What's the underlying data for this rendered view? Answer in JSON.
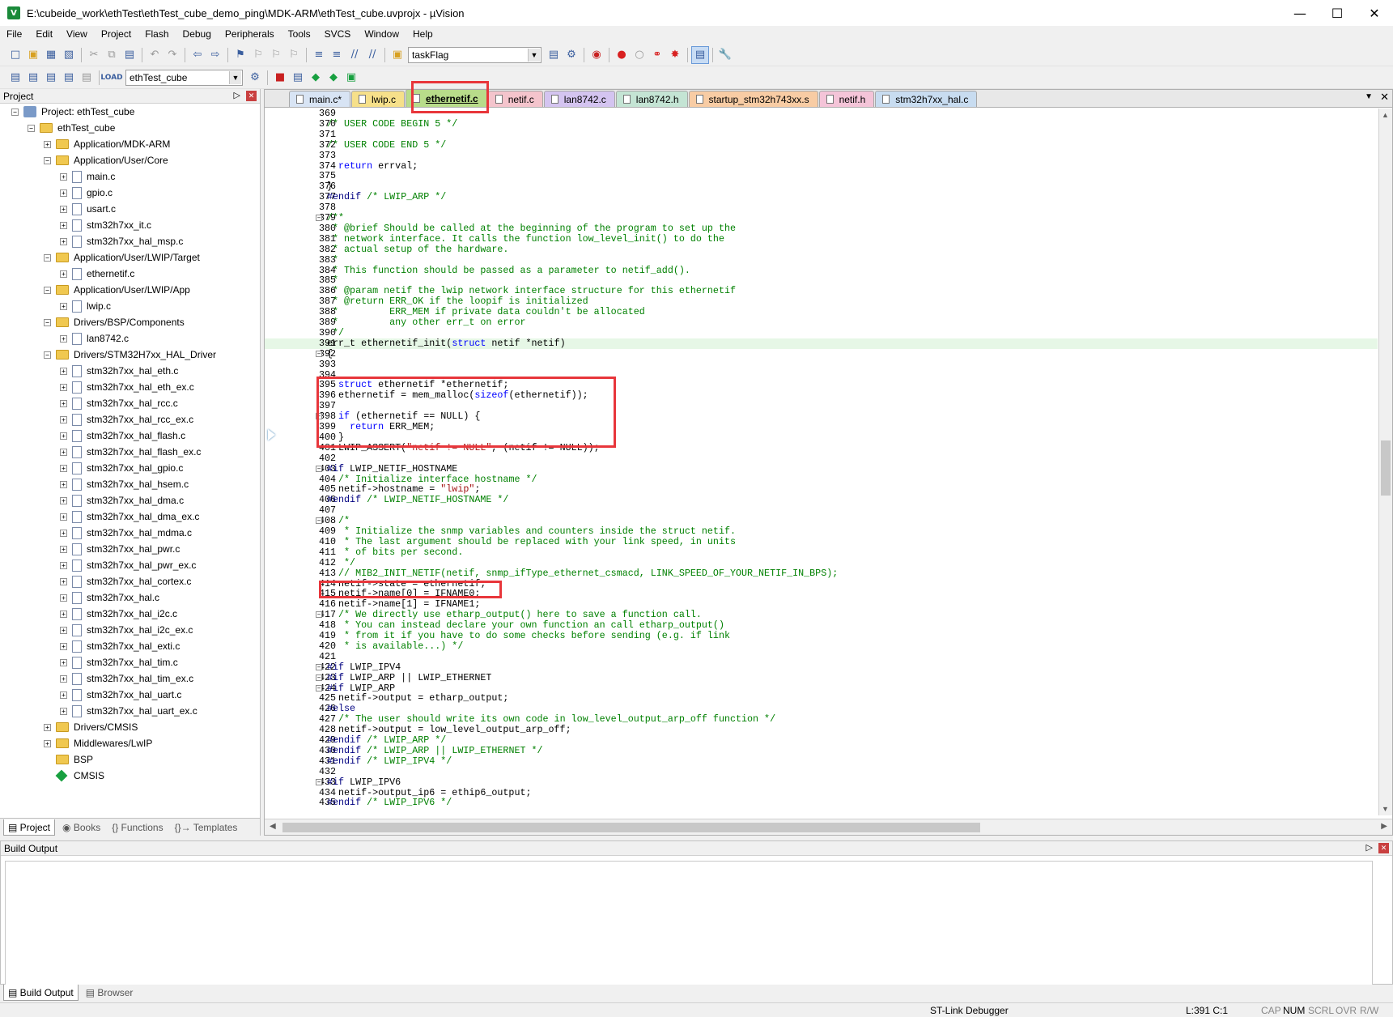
{
  "window": {
    "title": "E:\\cubeide_work\\ethTest\\ethTest_cube_demo_ping\\MDK-ARM\\ethTest_cube.uvprojx - µVision",
    "minimize": "—",
    "maximize": "☐",
    "close": "✕"
  },
  "menu": [
    "File",
    "Edit",
    "View",
    "Project",
    "Flash",
    "Debug",
    "Peripherals",
    "Tools",
    "SVCS",
    "Window",
    "Help"
  ],
  "toolbar": {
    "find_combo": "taskFlag",
    "target_combo": "ethTest_cube"
  },
  "project_panel": {
    "title": "Project",
    "tree": [
      {
        "label": "Project: ethTest_cube",
        "level": 0,
        "kind": "project",
        "expander": "−"
      },
      {
        "label": "ethTest_cube",
        "level": 1,
        "kind": "target",
        "expander": "−"
      },
      {
        "label": "Application/MDK-ARM",
        "level": 2,
        "kind": "folder",
        "expander": "+"
      },
      {
        "label": "Application/User/Core",
        "level": 2,
        "kind": "folder",
        "expander": "−"
      },
      {
        "label": "main.c",
        "level": 3,
        "kind": "file",
        "expander": "+"
      },
      {
        "label": "gpio.c",
        "level": 3,
        "kind": "file",
        "expander": "+"
      },
      {
        "label": "usart.c",
        "level": 3,
        "kind": "file",
        "expander": "+"
      },
      {
        "label": "stm32h7xx_it.c",
        "level": 3,
        "kind": "file",
        "expander": "+"
      },
      {
        "label": "stm32h7xx_hal_msp.c",
        "level": 3,
        "kind": "file",
        "expander": "+"
      },
      {
        "label": "Application/User/LWIP/Target",
        "level": 2,
        "kind": "folder",
        "expander": "−"
      },
      {
        "label": "ethernetif.c",
        "level": 3,
        "kind": "file",
        "expander": "+"
      },
      {
        "label": "Application/User/LWIP/App",
        "level": 2,
        "kind": "folder",
        "expander": "−"
      },
      {
        "label": "lwip.c",
        "level": 3,
        "kind": "file",
        "expander": "+"
      },
      {
        "label": "Drivers/BSP/Components",
        "level": 2,
        "kind": "folder",
        "expander": "−"
      },
      {
        "label": "lan8742.c",
        "level": 3,
        "kind": "file",
        "expander": "+"
      },
      {
        "label": "Drivers/STM32H7xx_HAL_Driver",
        "level": 2,
        "kind": "folder",
        "expander": "−"
      },
      {
        "label": "stm32h7xx_hal_eth.c",
        "level": 3,
        "kind": "file",
        "expander": "+"
      },
      {
        "label": "stm32h7xx_hal_eth_ex.c",
        "level": 3,
        "kind": "file",
        "expander": "+"
      },
      {
        "label": "stm32h7xx_hal_rcc.c",
        "level": 3,
        "kind": "file",
        "expander": "+"
      },
      {
        "label": "stm32h7xx_hal_rcc_ex.c",
        "level": 3,
        "kind": "file",
        "expander": "+"
      },
      {
        "label": "stm32h7xx_hal_flash.c",
        "level": 3,
        "kind": "file",
        "expander": "+"
      },
      {
        "label": "stm32h7xx_hal_flash_ex.c",
        "level": 3,
        "kind": "file",
        "expander": "+"
      },
      {
        "label": "stm32h7xx_hal_gpio.c",
        "level": 3,
        "kind": "file",
        "expander": "+"
      },
      {
        "label": "stm32h7xx_hal_hsem.c",
        "level": 3,
        "kind": "file",
        "expander": "+"
      },
      {
        "label": "stm32h7xx_hal_dma.c",
        "level": 3,
        "kind": "file",
        "expander": "+"
      },
      {
        "label": "stm32h7xx_hal_dma_ex.c",
        "level": 3,
        "kind": "file",
        "expander": "+"
      },
      {
        "label": "stm32h7xx_hal_mdma.c",
        "level": 3,
        "kind": "file",
        "expander": "+"
      },
      {
        "label": "stm32h7xx_hal_pwr.c",
        "level": 3,
        "kind": "file",
        "expander": "+"
      },
      {
        "label": "stm32h7xx_hal_pwr_ex.c",
        "level": 3,
        "kind": "file",
        "expander": "+"
      },
      {
        "label": "stm32h7xx_hal_cortex.c",
        "level": 3,
        "kind": "file",
        "expander": "+"
      },
      {
        "label": "stm32h7xx_hal.c",
        "level": 3,
        "kind": "file",
        "expander": "+"
      },
      {
        "label": "stm32h7xx_hal_i2c.c",
        "level": 3,
        "kind": "file",
        "expander": "+"
      },
      {
        "label": "stm32h7xx_hal_i2c_ex.c",
        "level": 3,
        "kind": "file",
        "expander": "+"
      },
      {
        "label": "stm32h7xx_hal_exti.c",
        "level": 3,
        "kind": "file",
        "expander": "+"
      },
      {
        "label": "stm32h7xx_hal_tim.c",
        "level": 3,
        "kind": "file",
        "expander": "+"
      },
      {
        "label": "stm32h7xx_hal_tim_ex.c",
        "level": 3,
        "kind": "file",
        "expander": "+"
      },
      {
        "label": "stm32h7xx_hal_uart.c",
        "level": 3,
        "kind": "file",
        "expander": "+"
      },
      {
        "label": "stm32h7xx_hal_uart_ex.c",
        "level": 3,
        "kind": "file",
        "expander": "+"
      },
      {
        "label": "Drivers/CMSIS",
        "level": 2,
        "kind": "folder",
        "expander": "+"
      },
      {
        "label": "Middlewares/LwIP",
        "level": 2,
        "kind": "folder",
        "expander": "+"
      },
      {
        "label": "BSP",
        "level": 2,
        "kind": "folder",
        "expander": ""
      },
      {
        "label": "CMSIS",
        "level": 2,
        "kind": "cmsis",
        "expander": ""
      }
    ],
    "tabs": [
      "Project",
      "Books",
      "{} Functions",
      "{}→ Templates"
    ]
  },
  "editor": {
    "tabs": [
      {
        "label": "main.c*",
        "color": "#d8e4f4"
      },
      {
        "label": "lwip.c",
        "color": "#f6e08a"
      },
      {
        "label": "ethernetif.c",
        "color": "#b8dc8a",
        "active": true
      },
      {
        "label": "netif.c",
        "color": "#f4c4cc"
      },
      {
        "label": "lan8742.c",
        "color": "#d4c4f0"
      },
      {
        "label": "lan8742.h",
        "color": "#c4e4d4"
      },
      {
        "label": "startup_stm32h743xx.s",
        "color": "#f8cca4"
      },
      {
        "label": "netif.h",
        "color": "#f4c4d8"
      },
      {
        "label": "stm32h7xx_hal.c",
        "color": "#c8dcf0"
      }
    ],
    "current_line": 391,
    "lines": [
      {
        "n": "369",
        "f": "",
        "h": ""
      },
      {
        "n": "370",
        "f": "",
        "h": "<span class=\"cmt\">/* USER CODE BEGIN 5 */</span>"
      },
      {
        "n": "371",
        "f": "",
        "h": ""
      },
      {
        "n": "372",
        "f": "",
        "h": "<span class=\"cmt\">/* USER CODE END 5 */</span>"
      },
      {
        "n": "373",
        "f": "",
        "h": ""
      },
      {
        "n": "374",
        "f": "",
        "h": "  <span class=\"kw\">return</span> errval;"
      },
      {
        "n": "375",
        "f": "",
        "h": ""
      },
      {
        "n": "376",
        "f": "",
        "h": "}"
      },
      {
        "n": "377",
        "f": "",
        "h": "<span class=\"pp\">#endif</span> <span class=\"cmt\">/* LWIP_ARP */</span>"
      },
      {
        "n": "378",
        "f": "",
        "h": ""
      },
      {
        "n": "379",
        "f": "−",
        "h": "<span class=\"cmt\">/**</span>"
      },
      {
        "n": "380",
        "f": "",
        "h": "<span class=\"cmt\"> * @brief Should be called at the beginning of the program to set up the</span>"
      },
      {
        "n": "381",
        "f": "",
        "h": "<span class=\"cmt\"> * network interface. It calls the function low_level_init() to do the</span>"
      },
      {
        "n": "382",
        "f": "",
        "h": "<span class=\"cmt\"> * actual setup of the hardware.</span>"
      },
      {
        "n": "383",
        "f": "",
        "h": "<span class=\"cmt\"> *</span>"
      },
      {
        "n": "384",
        "f": "",
        "h": "<span class=\"cmt\"> * This function should be passed as a parameter to netif_add().</span>"
      },
      {
        "n": "385",
        "f": "",
        "h": "<span class=\"cmt\"> *</span>"
      },
      {
        "n": "386",
        "f": "",
        "h": "<span class=\"cmt\"> * @param netif the lwip network interface structure for this ethernetif</span>"
      },
      {
        "n": "387",
        "f": "",
        "h": "<span class=\"cmt\"> * @return ERR_OK if the loopif is initialized</span>"
      },
      {
        "n": "388",
        "f": "",
        "h": "<span class=\"cmt\"> *         ERR_MEM if private data couldn't be allocated</span>"
      },
      {
        "n": "389",
        "f": "",
        "h": "<span class=\"cmt\"> *         any other err_t on error</span>"
      },
      {
        "n": "390",
        "f": "",
        "h": "<span class=\"cmt\"> */</span>"
      },
      {
        "n": "391",
        "f": "",
        "h": "err_t ethernetif_init(<span class=\"kw\">struct</span> netif *netif)"
      },
      {
        "n": "392",
        "f": "−",
        "h": "{"
      },
      {
        "n": "393",
        "f": "",
        "h": ""
      },
      {
        "n": "394",
        "f": "",
        "h": ""
      },
      {
        "n": "395",
        "f": "",
        "h": "  <span class=\"kw\">struct</span> ethernetif *ethernetif;"
      },
      {
        "n": "396",
        "f": "",
        "h": "  ethernetif = mem_malloc(<span class=\"kw\">sizeof</span>(ethernetif));"
      },
      {
        "n": "397",
        "f": "",
        "h": ""
      },
      {
        "n": "398",
        "f": "−",
        "h": "  <span class=\"kw\">if</span> (ethernetif == NULL) {"
      },
      {
        "n": "399",
        "f": "",
        "h": "    <span class=\"kw\">return</span> ERR_MEM;"
      },
      {
        "n": "400",
        "f": "",
        "h": "  }"
      },
      {
        "n": "401",
        "f": "",
        "h": "  LWIP_ASSERT(<span class=\"str\">\"netif != NULL\"</span>, (netif != NULL));"
      },
      {
        "n": "402",
        "f": "",
        "h": ""
      },
      {
        "n": "403",
        "f": "−",
        "h": "<span class=\"pp\">#if</span> LWIP_NETIF_HOSTNAME"
      },
      {
        "n": "404",
        "f": "",
        "h": "  <span class=\"cmt\">/* Initialize interface hostname */</span>"
      },
      {
        "n": "405",
        "f": "",
        "h": "  netif-&gt;hostname = <span class=\"str\">\"lwip\"</span>;"
      },
      {
        "n": "406",
        "f": "",
        "h": "<span class=\"pp\">#endif</span> <span class=\"cmt\">/* LWIP_NETIF_HOSTNAME */</span>"
      },
      {
        "n": "407",
        "f": "",
        "h": ""
      },
      {
        "n": "408",
        "f": "−",
        "h": "  <span class=\"cmt\">/*</span>"
      },
      {
        "n": "409",
        "f": "",
        "h": "<span class=\"cmt\">   * Initialize the snmp variables and counters inside the struct netif.</span>"
      },
      {
        "n": "410",
        "f": "",
        "h": "<span class=\"cmt\">   * The last argument should be replaced with your link speed, in units</span>"
      },
      {
        "n": "411",
        "f": "",
        "h": "<span class=\"cmt\">   * of bits per second.</span>"
      },
      {
        "n": "412",
        "f": "",
        "h": "<span class=\"cmt\">   */</span>"
      },
      {
        "n": "413",
        "f": "",
        "h": "  <span class=\"cmt\">// MIB2_INIT_NETIF(netif, snmp_ifType_ethernet_csmacd, LINK_SPEED_OF_YOUR_NETIF_IN_BPS);</span>"
      },
      {
        "n": "414",
        "f": "",
        "h": "  netif-&gt;state = ethernetif;"
      },
      {
        "n": "415",
        "f": "",
        "h": "  netif-&gt;name[0] = IFNAME0;"
      },
      {
        "n": "416",
        "f": "",
        "h": "  netif-&gt;name[1] = IFNAME1;"
      },
      {
        "n": "417",
        "f": "−",
        "h": "  <span class=\"cmt\">/* We directly use etharp_output() here to save a function call.</span>"
      },
      {
        "n": "418",
        "f": "",
        "h": "<span class=\"cmt\">   * You can instead declare your own function an call etharp_output()</span>"
      },
      {
        "n": "419",
        "f": "",
        "h": "<span class=\"cmt\">   * from it if you have to do some checks before sending (e.g. if link</span>"
      },
      {
        "n": "420",
        "f": "",
        "h": "<span class=\"cmt\">   * is available...) */</span>"
      },
      {
        "n": "421",
        "f": "",
        "h": ""
      },
      {
        "n": "422",
        "f": "−",
        "h": "<span class=\"pp\">#if</span> LWIP_IPV4"
      },
      {
        "n": "423",
        "f": "−",
        "h": "<span class=\"pp\">#if</span> LWIP_ARP || LWIP_ETHERNET"
      },
      {
        "n": "424",
        "f": "−",
        "h": "<span class=\"pp\">#if</span> LWIP_ARP"
      },
      {
        "n": "425",
        "f": "",
        "h": "  netif-&gt;output = etharp_output;"
      },
      {
        "n": "426",
        "f": "",
        "h": "<span class=\"pp\">#else</span>"
      },
      {
        "n": "427",
        "f": "",
        "h": "  <span class=\"cmt\">/* The user should write its own code in low_level_output_arp_off function */</span>"
      },
      {
        "n": "428",
        "f": "",
        "h": "  netif-&gt;output = low_level_output_arp_off;"
      },
      {
        "n": "429",
        "f": "",
        "h": "<span class=\"pp\">#endif</span> <span class=\"cmt\">/* LWIP_ARP */</span>"
      },
      {
        "n": "430",
        "f": "",
        "h": "<span class=\"pp\">#endif</span> <span class=\"cmt\">/* LWIP_ARP || LWIP_ETHERNET */</span>"
      },
      {
        "n": "431",
        "f": "",
        "h": "<span class=\"pp\">#endif</span> <span class=\"cmt\">/* LWIP_IPV4 */</span>"
      },
      {
        "n": "432",
        "f": "",
        "h": ""
      },
      {
        "n": "433",
        "f": "−",
        "h": "<span class=\"pp\">#if</span> LWIP_IPV6"
      },
      {
        "n": "434",
        "f": "",
        "h": "  netif-&gt;output_ip6 = ethip6_output;"
      },
      {
        "n": "435",
        "f": "",
        "h": "<span class=\"pp\">#endif</span> <span class=\"cmt\">/* LWIP_IPV6 */</span>"
      }
    ]
  },
  "build_output": {
    "title": "Build Output",
    "tabs": [
      "Build Output",
      "Browser"
    ]
  },
  "status": {
    "debugger": "ST-Link Debugger",
    "position": "L:391 C:1",
    "cap": "CAP",
    "num": "NUM",
    "scrl": "SCRL",
    "ovr": "OVR",
    "rw": "R/W"
  }
}
